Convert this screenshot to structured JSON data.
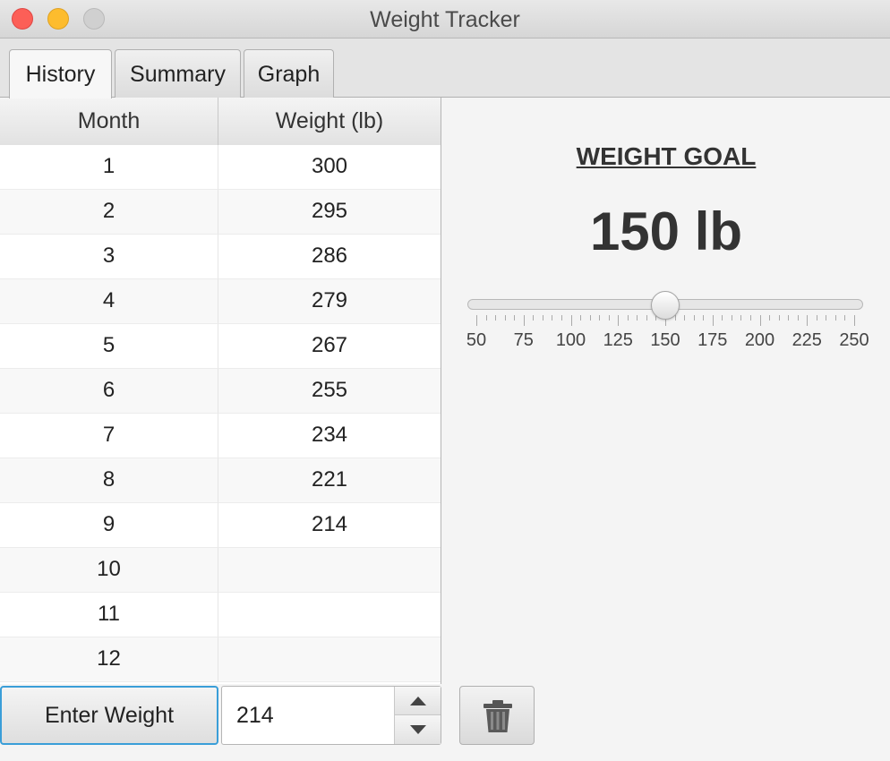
{
  "window": {
    "title": "Weight Tracker"
  },
  "tabs": [
    {
      "label": "History",
      "active": true
    },
    {
      "label": "Summary",
      "active": false
    },
    {
      "label": "Graph",
      "active": false
    }
  ],
  "table": {
    "columns": [
      "Month",
      "Weight (lb)"
    ],
    "rows": [
      {
        "month": "1",
        "weight": "300"
      },
      {
        "month": "2",
        "weight": "295"
      },
      {
        "month": "3",
        "weight": "286"
      },
      {
        "month": "4",
        "weight": "279"
      },
      {
        "month": "5",
        "weight": "267"
      },
      {
        "month": "6",
        "weight": "255"
      },
      {
        "month": "7",
        "weight": "234"
      },
      {
        "month": "8",
        "weight": "221"
      },
      {
        "month": "9",
        "weight": "214"
      },
      {
        "month": "10",
        "weight": ""
      },
      {
        "month": "11",
        "weight": ""
      },
      {
        "month": "12",
        "weight": ""
      }
    ]
  },
  "goal": {
    "title": "WEIGHT GOAL",
    "value_text": "150 lb",
    "slider": {
      "min": 50,
      "max": 250,
      "value": 150,
      "major_tick_unit": 25,
      "minor_ticks_per_major": 4,
      "labels": [
        "50",
        "75",
        "100",
        "125",
        "150",
        "175",
        "200",
        "225",
        "250"
      ]
    }
  },
  "controls": {
    "enter_button_label": "Enter Weight",
    "weight_input_value": "214",
    "delete_icon": "trash-icon"
  },
  "colors": {
    "focus_accent": "#3a9ed8",
    "close": "#fc5f57",
    "minimize": "#fdbc2e"
  }
}
